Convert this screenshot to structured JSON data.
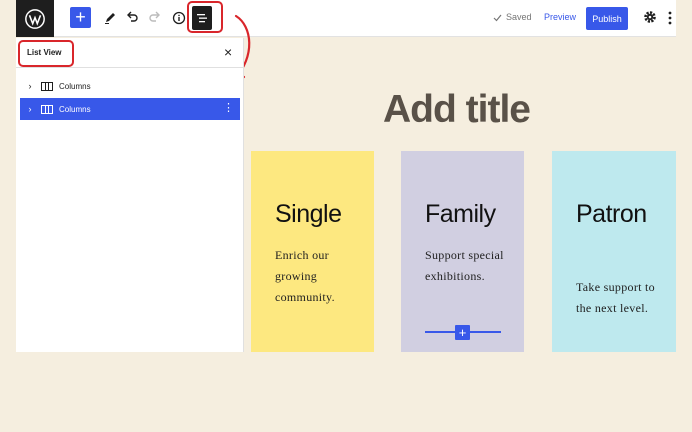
{
  "toolbar": {
    "add_symbol": "+",
    "saved_label": "Saved",
    "preview_label": "Preview",
    "publish_label": "Publish",
    "icons": [
      "wordpress-logo",
      "pencil",
      "undo",
      "redo",
      "info",
      "list-view",
      "gear",
      "more-vertical"
    ]
  },
  "list_view": {
    "title": "List View",
    "close_symbol": "×",
    "items": [
      {
        "label": "Columns",
        "selected": false
      },
      {
        "label": "Columns",
        "selected": true
      }
    ]
  },
  "content": {
    "page_title": "Add title",
    "cards": [
      {
        "heading": "Single",
        "text": "Enrich our growing community.",
        "color": "#fde880"
      },
      {
        "heading": "Family",
        "text": "Support special exhibitions.",
        "color": "#d1cfe1"
      },
      {
        "heading": "Patron",
        "text": "Take support to the next level.",
        "color": "#bee9ee"
      }
    ],
    "inserter_symbol": "+"
  },
  "colors": {
    "accent": "#3858e9",
    "highlight": "#d9262b",
    "page_background": "#f5eedf"
  }
}
